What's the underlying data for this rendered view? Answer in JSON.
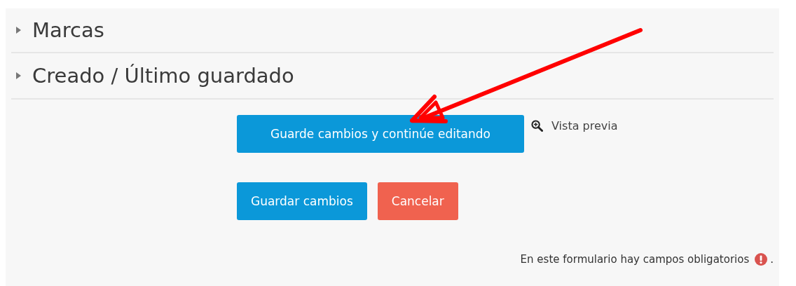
{
  "sections": [
    {
      "title": "Marcas",
      "expanded": false
    },
    {
      "title": "Creado / Último guardado",
      "expanded": false
    }
  ],
  "continue_button": {
    "label": "Guarde cambios y continúe editando",
    "kind": "primary"
  },
  "preview_link": {
    "label": "Vista previa"
  },
  "buttons": [
    {
      "label": "Guardar cambios",
      "kind": "primary"
    },
    {
      "label": "Cancelar",
      "kind": "danger"
    }
  ],
  "required_note": {
    "text": "En este formulario hay campos obligatorios",
    "suffix": "."
  }
}
